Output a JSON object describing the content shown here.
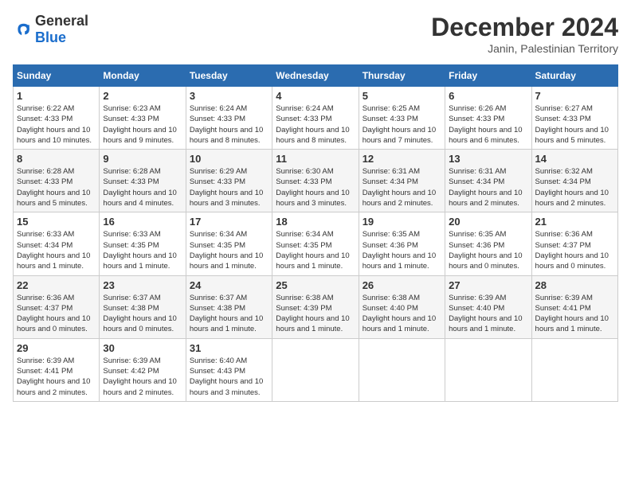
{
  "logo": {
    "text_general": "General",
    "text_blue": "Blue"
  },
  "title": {
    "month": "December 2024",
    "location": "Janin, Palestinian Territory"
  },
  "weekdays": [
    "Sunday",
    "Monday",
    "Tuesday",
    "Wednesday",
    "Thursday",
    "Friday",
    "Saturday"
  ],
  "weeks": [
    [
      {
        "day": "1",
        "sunrise": "6:22 AM",
        "sunset": "4:33 PM",
        "daylight": "10 hours and 10 minutes."
      },
      {
        "day": "2",
        "sunrise": "6:23 AM",
        "sunset": "4:33 PM",
        "daylight": "10 hours and 9 minutes."
      },
      {
        "day": "3",
        "sunrise": "6:24 AM",
        "sunset": "4:33 PM",
        "daylight": "10 hours and 8 minutes."
      },
      {
        "day": "4",
        "sunrise": "6:24 AM",
        "sunset": "4:33 PM",
        "daylight": "10 hours and 8 minutes."
      },
      {
        "day": "5",
        "sunrise": "6:25 AM",
        "sunset": "4:33 PM",
        "daylight": "10 hours and 7 minutes."
      },
      {
        "day": "6",
        "sunrise": "6:26 AM",
        "sunset": "4:33 PM",
        "daylight": "10 hours and 6 minutes."
      },
      {
        "day": "7",
        "sunrise": "6:27 AM",
        "sunset": "4:33 PM",
        "daylight": "10 hours and 5 minutes."
      }
    ],
    [
      {
        "day": "8",
        "sunrise": "6:28 AM",
        "sunset": "4:33 PM",
        "daylight": "10 hours and 5 minutes."
      },
      {
        "day": "9",
        "sunrise": "6:28 AM",
        "sunset": "4:33 PM",
        "daylight": "10 hours and 4 minutes."
      },
      {
        "day": "10",
        "sunrise": "6:29 AM",
        "sunset": "4:33 PM",
        "daylight": "10 hours and 3 minutes."
      },
      {
        "day": "11",
        "sunrise": "6:30 AM",
        "sunset": "4:33 PM",
        "daylight": "10 hours and 3 minutes."
      },
      {
        "day": "12",
        "sunrise": "6:31 AM",
        "sunset": "4:34 PM",
        "daylight": "10 hours and 2 minutes."
      },
      {
        "day": "13",
        "sunrise": "6:31 AM",
        "sunset": "4:34 PM",
        "daylight": "10 hours and 2 minutes."
      },
      {
        "day": "14",
        "sunrise": "6:32 AM",
        "sunset": "4:34 PM",
        "daylight": "10 hours and 2 minutes."
      }
    ],
    [
      {
        "day": "15",
        "sunrise": "6:33 AM",
        "sunset": "4:34 PM",
        "daylight": "10 hours and 1 minute."
      },
      {
        "day": "16",
        "sunrise": "6:33 AM",
        "sunset": "4:35 PM",
        "daylight": "10 hours and 1 minute."
      },
      {
        "day": "17",
        "sunrise": "6:34 AM",
        "sunset": "4:35 PM",
        "daylight": "10 hours and 1 minute."
      },
      {
        "day": "18",
        "sunrise": "6:34 AM",
        "sunset": "4:35 PM",
        "daylight": "10 hours and 1 minute."
      },
      {
        "day": "19",
        "sunrise": "6:35 AM",
        "sunset": "4:36 PM",
        "daylight": "10 hours and 1 minute."
      },
      {
        "day": "20",
        "sunrise": "6:35 AM",
        "sunset": "4:36 PM",
        "daylight": "10 hours and 0 minutes."
      },
      {
        "day": "21",
        "sunrise": "6:36 AM",
        "sunset": "4:37 PM",
        "daylight": "10 hours and 0 minutes."
      }
    ],
    [
      {
        "day": "22",
        "sunrise": "6:36 AM",
        "sunset": "4:37 PM",
        "daylight": "10 hours and 0 minutes."
      },
      {
        "day": "23",
        "sunrise": "6:37 AM",
        "sunset": "4:38 PM",
        "daylight": "10 hours and 0 minutes."
      },
      {
        "day": "24",
        "sunrise": "6:37 AM",
        "sunset": "4:38 PM",
        "daylight": "10 hours and 1 minute."
      },
      {
        "day": "25",
        "sunrise": "6:38 AM",
        "sunset": "4:39 PM",
        "daylight": "10 hours and 1 minute."
      },
      {
        "day": "26",
        "sunrise": "6:38 AM",
        "sunset": "4:40 PM",
        "daylight": "10 hours and 1 minute."
      },
      {
        "day": "27",
        "sunrise": "6:39 AM",
        "sunset": "4:40 PM",
        "daylight": "10 hours and 1 minute."
      },
      {
        "day": "28",
        "sunrise": "6:39 AM",
        "sunset": "4:41 PM",
        "daylight": "10 hours and 1 minute."
      }
    ],
    [
      {
        "day": "29",
        "sunrise": "6:39 AM",
        "sunset": "4:41 PM",
        "daylight": "10 hours and 2 minutes."
      },
      {
        "day": "30",
        "sunrise": "6:39 AM",
        "sunset": "4:42 PM",
        "daylight": "10 hours and 2 minutes."
      },
      {
        "day": "31",
        "sunrise": "6:40 AM",
        "sunset": "4:43 PM",
        "daylight": "10 hours and 3 minutes."
      },
      null,
      null,
      null,
      null
    ]
  ]
}
